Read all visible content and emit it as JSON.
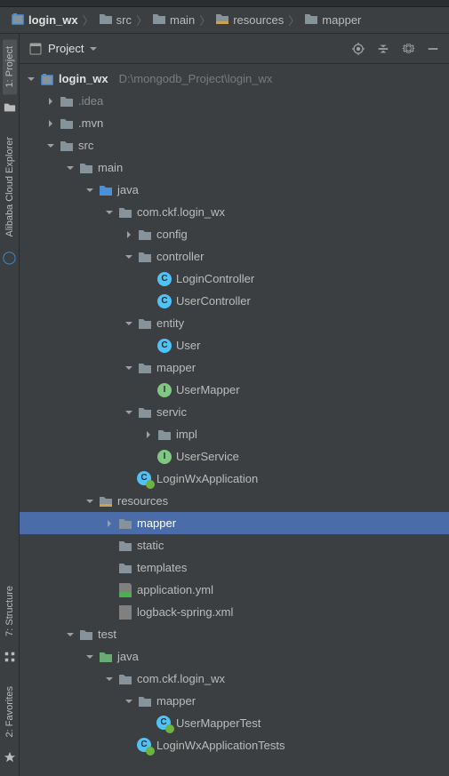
{
  "breadcrumbs": [
    {
      "label": "login_wx",
      "icon": "module"
    },
    {
      "label": "src",
      "icon": "folder"
    },
    {
      "label": "main",
      "icon": "folder"
    },
    {
      "label": "resources",
      "icon": "resources"
    },
    {
      "label": "mapper",
      "icon": "folder"
    }
  ],
  "panel": {
    "title": "Project"
  },
  "dock": {
    "tabs": [
      {
        "id": "project",
        "label": "1: Project"
      },
      {
        "id": "alibaba",
        "label": "Alibaba Cloud Explorer"
      },
      {
        "id": "structure",
        "label": "7: Structure"
      },
      {
        "id": "favorites",
        "label": "2: Favorites"
      }
    ]
  },
  "project_root": {
    "name": "login_wx",
    "hint": "D:\\mongodb_Project\\login_wx"
  },
  "tree": [
    {
      "d": 0,
      "exp": "down",
      "icon": "module",
      "label": "login_wx",
      "labelClass": "mod",
      "hint": "D:\\mongodb_Project\\login_wx"
    },
    {
      "d": 1,
      "exp": "right",
      "icon": "folder-gray",
      "label": ".idea",
      "labelClass": "dim"
    },
    {
      "d": 1,
      "exp": "right",
      "icon": "folder-gray",
      "label": ".mvn"
    },
    {
      "d": 1,
      "exp": "down",
      "icon": "folder-gray",
      "label": "src"
    },
    {
      "d": 2,
      "exp": "down",
      "icon": "folder-gray",
      "label": "main"
    },
    {
      "d": 3,
      "exp": "down",
      "icon": "folder-blue",
      "label": "java"
    },
    {
      "d": 4,
      "exp": "down",
      "icon": "package",
      "label": "com.ckf.login_wx"
    },
    {
      "d": 5,
      "exp": "right",
      "icon": "package",
      "label": "config"
    },
    {
      "d": 5,
      "exp": "down",
      "icon": "package",
      "label": "controller"
    },
    {
      "d": 6,
      "exp": "none",
      "icon": "class-c",
      "label": "LoginController"
    },
    {
      "d": 6,
      "exp": "none",
      "icon": "class-c",
      "label": "UserController"
    },
    {
      "d": 5,
      "exp": "down",
      "icon": "package",
      "label": "entity"
    },
    {
      "d": 6,
      "exp": "none",
      "icon": "class-c",
      "label": "User"
    },
    {
      "d": 5,
      "exp": "down",
      "icon": "package",
      "label": "mapper"
    },
    {
      "d": 6,
      "exp": "none",
      "icon": "class-i",
      "label": "UserMapper"
    },
    {
      "d": 5,
      "exp": "down",
      "icon": "package",
      "label": "servic"
    },
    {
      "d": 6,
      "exp": "right",
      "icon": "package",
      "label": "impl"
    },
    {
      "d": 6,
      "exp": "none",
      "icon": "class-i",
      "label": "UserService"
    },
    {
      "d": 5,
      "exp": "none",
      "icon": "spring-class",
      "label": "LoginWxApplication"
    },
    {
      "d": 3,
      "exp": "down",
      "icon": "resources",
      "label": "resources"
    },
    {
      "d": 4,
      "exp": "right",
      "icon": "folder-gray",
      "label": "mapper",
      "selected": true
    },
    {
      "d": 4,
      "exp": "none",
      "icon": "folder-gray",
      "label": "static"
    },
    {
      "d": 4,
      "exp": "none",
      "icon": "folder-gray",
      "label": "templates"
    },
    {
      "d": 4,
      "exp": "none",
      "icon": "yml",
      "label": "application.yml"
    },
    {
      "d": 4,
      "exp": "none",
      "icon": "xml",
      "label": "logback-spring.xml"
    },
    {
      "d": 2,
      "exp": "down",
      "icon": "folder-gray",
      "label": "test"
    },
    {
      "d": 3,
      "exp": "down",
      "icon": "folder-green",
      "label": "java"
    },
    {
      "d": 4,
      "exp": "down",
      "icon": "package",
      "label": "com.ckf.login_wx"
    },
    {
      "d": 5,
      "exp": "down",
      "icon": "package",
      "label": "mapper"
    },
    {
      "d": 6,
      "exp": "none",
      "icon": "spring-class",
      "label": "UserMapperTest"
    },
    {
      "d": 5,
      "exp": "none",
      "icon": "spring-class",
      "label": "LoginWxApplicationTests"
    }
  ]
}
